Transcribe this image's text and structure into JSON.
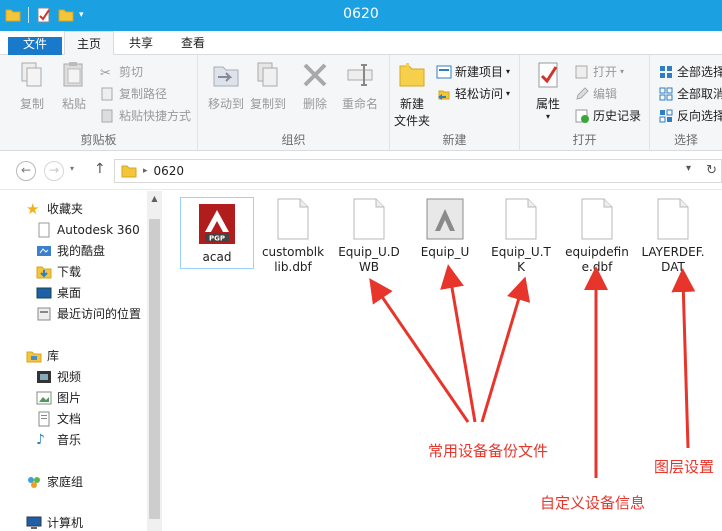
{
  "window": {
    "title": "0620"
  },
  "tabs": {
    "file": "文件",
    "home": "主页",
    "share": "共享",
    "view": "查看"
  },
  "ribbon": {
    "clipboard": {
      "label": "剪贴板",
      "copy": "复制",
      "paste": "粘贴",
      "cut": "剪切",
      "copy_path": "复制路径",
      "paste_shortcut": "粘贴快捷方式"
    },
    "organize": {
      "label": "组织",
      "move_to": "移动到",
      "copy_to": "复制到",
      "delete": "删除",
      "rename": "重命名"
    },
    "new": {
      "label": "新建",
      "new_folder": "新建\n文件夹",
      "new_folder_l1": "新建",
      "new_folder_l2": "文件夹",
      "new_item": "新建项目",
      "easy_access": "轻松访问"
    },
    "open": {
      "label": "打开",
      "properties": "属性",
      "open": "打开",
      "edit": "编辑",
      "history": "历史记录"
    },
    "select": {
      "label": "选择",
      "select_all": "全部选择",
      "select_none": "全部取消",
      "invert": "反向选择"
    }
  },
  "address": {
    "path": "0620"
  },
  "nav": {
    "favorites": "收藏夹",
    "autodesk": "Autodesk 360",
    "kuaipan": "我的酷盘",
    "downloads": "下载",
    "desktop": "桌面",
    "recent": "最近访问的位置",
    "libraries": "库",
    "videos": "视频",
    "pictures": "图片",
    "documents": "文档",
    "music": "音乐",
    "homegroup": "家庭组",
    "computer": "计算机"
  },
  "files": [
    {
      "name": "acad",
      "icon": "pgp-icon"
    },
    {
      "name": "customblklib.dbf",
      "icon": "blank-file-icon"
    },
    {
      "name": "Equip_U.DWB",
      "icon": "blank-file-icon"
    },
    {
      "name": "Equip_U",
      "icon": "autocad-file-icon"
    },
    {
      "name": "Equip_U.TK",
      "icon": "blank-file-icon"
    },
    {
      "name": "equipdefine.dbf",
      "icon": "blank-file-icon"
    },
    {
      "name": "LAYERDEF.DAT",
      "icon": "blank-file-icon"
    }
  ],
  "file_labels": {
    "f0": "acad",
    "f1a": "customblk",
    "f1b": "lib.dbf",
    "f2a": "Equip_U.D",
    "f2b": "WB",
    "f3": "Equip_U",
    "f4a": "Equip_U.T",
    "f4b": "K",
    "f5a": "equipdefin",
    "f5b": "e.dbf",
    "f6a": "LAYERDEF.",
    "f6b": "DAT"
  },
  "annotations": {
    "backup": "常用设备备份文件",
    "custom": "自定义设备信息",
    "layer": "图层设置"
  },
  "colors": {
    "titlebar": "#1ba1e2",
    "file_tab": "#1979ca",
    "annotation": "#e8352b"
  }
}
